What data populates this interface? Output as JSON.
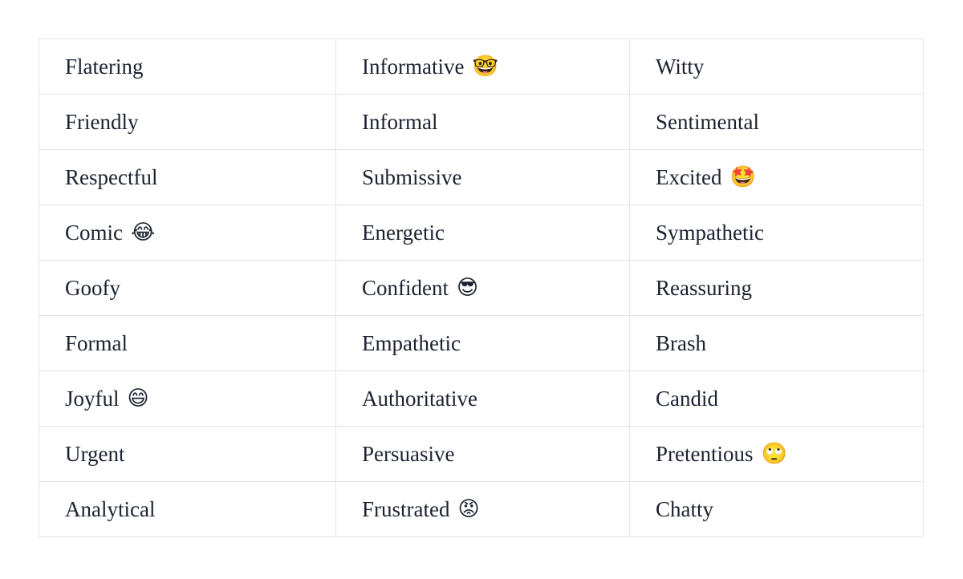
{
  "document": {
    "faint_top_text": "",
    "background_color": "#ffffff",
    "border_color": "#dfe3ec",
    "text_color": "#1b2230"
  },
  "table": {
    "name": "tone-of-voice-table",
    "rows": [
      [
        {
          "label": "Flatering",
          "emoji": ""
        },
        {
          "label": "Informative",
          "emoji": "🤓",
          "emoji_name": "nerd-face-emoji"
        },
        {
          "label": "Witty",
          "emoji": ""
        }
      ],
      [
        {
          "label": "Friendly",
          "emoji": ""
        },
        {
          "label": "Informal",
          "emoji": ""
        },
        {
          "label": "Sentimental",
          "emoji": ""
        }
      ],
      [
        {
          "label": "Respectful",
          "emoji": ""
        },
        {
          "label": "Submissive",
          "emoji": ""
        },
        {
          "label": "Excited",
          "emoji": "🤩",
          "emoji_name": "star-struck-emoji"
        }
      ],
      [
        {
          "label": "Comic",
          "emoji": "😂",
          "emoji_name": "face-with-tears-of-joy-emoji"
        },
        {
          "label": "Energetic",
          "emoji": ""
        },
        {
          "label": "Sympathetic",
          "emoji": ""
        }
      ],
      [
        {
          "label": "Goofy",
          "emoji": ""
        },
        {
          "label": "Confident",
          "emoji": "😎",
          "emoji_name": "smiling-face-with-sunglasses-emoji"
        },
        {
          "label": "Reassuring",
          "emoji": ""
        }
      ],
      [
        {
          "label": "Formal",
          "emoji": ""
        },
        {
          "label": "Empathetic",
          "emoji": ""
        },
        {
          "label": "Brash",
          "emoji": ""
        }
      ],
      [
        {
          "label": "Joyful",
          "emoji": "😄",
          "emoji_name": "grinning-face-with-smiling-eyes-emoji"
        },
        {
          "label": "Authoritative",
          "emoji": ""
        },
        {
          "label": "Candid",
          "emoji": ""
        }
      ],
      [
        {
          "label": "Urgent",
          "emoji": ""
        },
        {
          "label": "Persuasive",
          "emoji": ""
        },
        {
          "label": "Pretentious",
          "emoji": "🙄",
          "emoji_name": "face-with-rolling-eyes-emoji"
        }
      ],
      [
        {
          "label": "Analytical",
          "emoji": ""
        },
        {
          "label": "Frustrated",
          "emoji": "😡",
          "emoji_name": "pouting-face-emoji"
        },
        {
          "label": "Chatty",
          "emoji": ""
        }
      ]
    ]
  }
}
